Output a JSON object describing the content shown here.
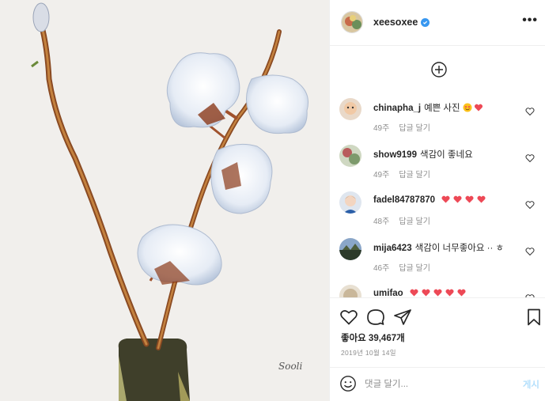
{
  "post": {
    "author": "xeesoxee",
    "signature": "Sooli",
    "likes_text": "좋아요 39,467개",
    "date": "2019년 10월 14일",
    "comment_placeholder": "댓글 달기...",
    "post_label": "게시"
  },
  "comments": [
    {
      "user": "chinapha_j",
      "text": "예쁜 사진",
      "emoji": [
        "heart-eyes",
        "red-heart"
      ],
      "age": "49주",
      "reply": "답글 달기"
    },
    {
      "user": "show9199",
      "text": "색감이 좋네요",
      "emoji": [],
      "age": "49주",
      "reply": "답글 달기"
    },
    {
      "user": "fadel84787870",
      "text": "",
      "emoji": [
        "red-heart",
        "red-heart",
        "red-heart",
        "red-heart"
      ],
      "age": "48주",
      "reply": "답글 달기"
    },
    {
      "user": "mija6423",
      "text": "색감이 너무좋아요 ·· ㅎ",
      "emoji": [],
      "age": "46주",
      "reply": "답글 달기"
    },
    {
      "user": "umifao",
      "text": "",
      "emoji": [
        "red-heart",
        "red-heart",
        "red-heart",
        "red-heart",
        "red-heart"
      ],
      "age": "",
      "reply": ""
    }
  ],
  "icons": {
    "more": "more-options-icon",
    "load_more": "plus-circle-icon",
    "like": "heart-outline-icon",
    "comment": "comment-bubble-icon",
    "share": "paper-plane-icon",
    "save": "bookmark-icon",
    "emoji": "smiley-icon"
  },
  "colors": {
    "verified": "#3897f0",
    "heart": "#ed4956",
    "muted": "#8e8e8e",
    "post_disabled": "#b2dffc"
  },
  "ui": {
    "more_dots": "•••"
  }
}
